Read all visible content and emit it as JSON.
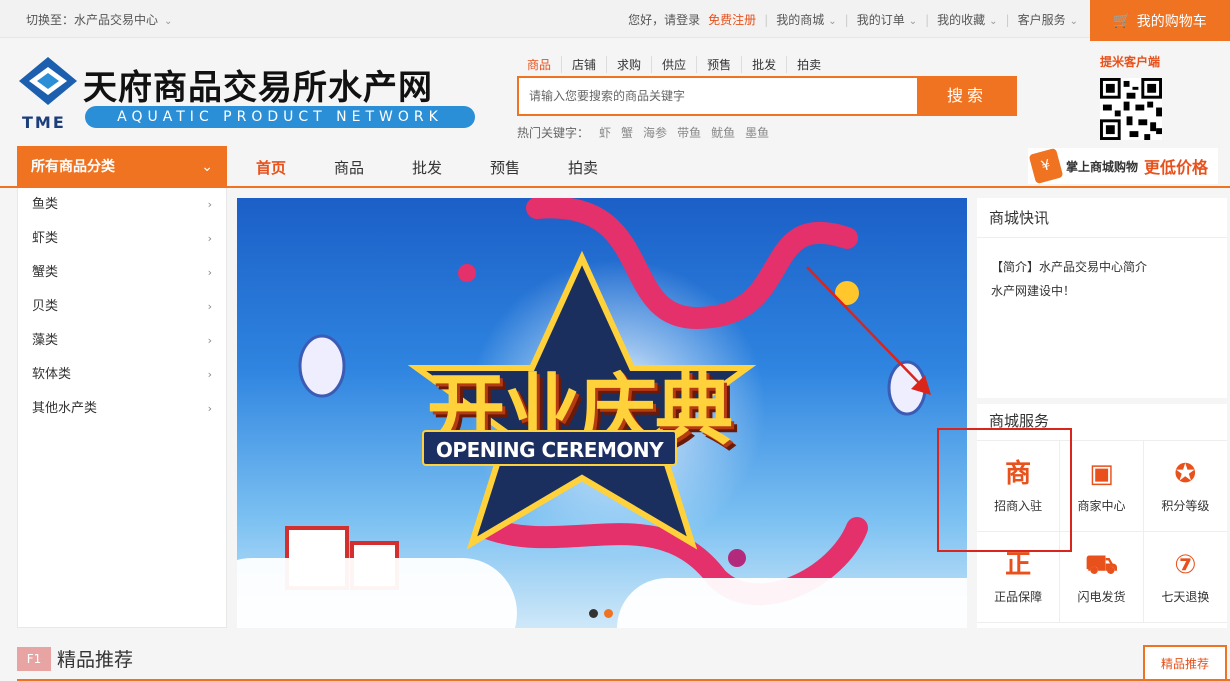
{
  "topbar": {
    "switch_label": "切换至：水产品交易中心",
    "greeting": "您好，请登录",
    "register": "免费注册",
    "my_mall": "我的商城",
    "my_orders": "我的订单",
    "my_favorites": "我的收藏",
    "customer_service": "客户服务",
    "cart": "我的购物车"
  },
  "logo": {
    "abbr": "TME",
    "name_cn": "天府商品交易所水产网",
    "name_en": "AQUATIC PRODUCT NETWORK"
  },
  "search": {
    "tabs": [
      "商品",
      "店铺",
      "求购",
      "供应",
      "预售",
      "批发",
      "拍卖"
    ],
    "placeholder": "请输入您要搜索的商品关键字",
    "button": "搜索",
    "hot_label": "热门关键字：",
    "hot_keywords": [
      "虾",
      "蟹",
      "海参",
      "带鱼",
      "鱿鱼",
      "墨鱼"
    ]
  },
  "qr": {
    "label": "提米客户端"
  },
  "nav": {
    "all_categories": "所有商品分类",
    "links": [
      "首页",
      "商品",
      "批发",
      "预售",
      "拍卖"
    ],
    "mobile_promo_1": "掌上商城购物",
    "mobile_promo_2": "更低价格"
  },
  "categories": [
    "鱼类",
    "虾类",
    "蟹类",
    "贝类",
    "藻类",
    "软体类",
    "其他水产类"
  ],
  "banner": {
    "title": "开业庆典",
    "subtitle": "OPENING CEREMONY"
  },
  "news": {
    "heading": "商城快讯",
    "items": [
      "【简介】水产品交易中心简介",
      "水产网建设中！"
    ]
  },
  "services": {
    "heading": "商城服务",
    "items": [
      {
        "label": "招商入驻",
        "icon": "商"
      },
      {
        "label": "商家中心",
        "icon": "▣"
      },
      {
        "label": "积分等级",
        "icon": "✪"
      },
      {
        "label": "正品保障",
        "icon": "正"
      },
      {
        "label": "闪电发货",
        "icon": "⛟"
      },
      {
        "label": "七天退换",
        "icon": "⑦"
      }
    ]
  },
  "floor": {
    "number": "F1",
    "title": "精品推荐",
    "tab": "精品推荐"
  },
  "colors": {
    "accent": "#f07321",
    "highlight": "#d9251c"
  }
}
